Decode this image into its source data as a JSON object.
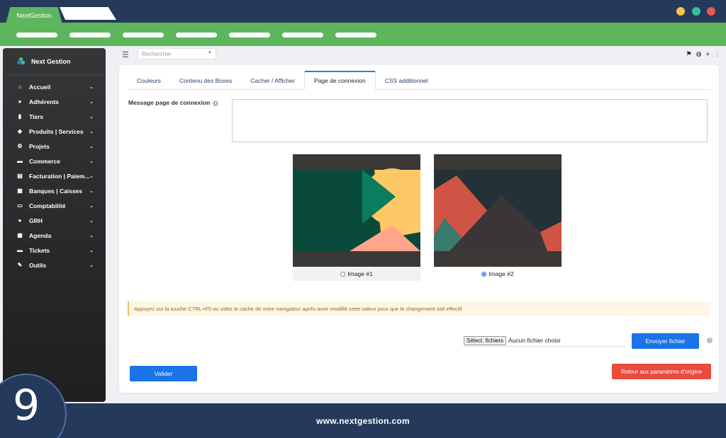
{
  "browser": {
    "tab_title": "NextGestion",
    "window_dots": [
      "#f5c542",
      "#3bbf9a",
      "#e9584f"
    ]
  },
  "sidebar": {
    "brand": "Next Gestion",
    "items": [
      {
        "label": "Accueil",
        "icon": "home-icon",
        "glyph": "⌂"
      },
      {
        "label": "Adhérents",
        "icon": "user-icon",
        "glyph": "●"
      },
      {
        "label": "Tiers",
        "icon": "building-icon",
        "glyph": "▮"
      },
      {
        "label": "Produits | Services",
        "icon": "cube-icon",
        "glyph": "◆"
      },
      {
        "label": "Projets",
        "icon": "project-icon",
        "glyph": "⚙"
      },
      {
        "label": "Commerce",
        "icon": "briefcase-icon",
        "glyph": "▬"
      },
      {
        "label": "Facturation | Paiem...",
        "icon": "invoice-icon",
        "glyph": "▤"
      },
      {
        "label": "Banques | Caisses",
        "icon": "bank-icon",
        "glyph": "▦"
      },
      {
        "label": "Comptabilité",
        "icon": "accounting-icon",
        "glyph": "▭"
      },
      {
        "label": "GRH",
        "icon": "user-tie-icon",
        "glyph": "●"
      },
      {
        "label": "Agenda",
        "icon": "calendar-icon",
        "glyph": "▦"
      },
      {
        "label": "Tickets",
        "icon": "ticket-icon",
        "glyph": "▬"
      },
      {
        "label": "Outils",
        "icon": "wrench-icon",
        "glyph": "✎"
      }
    ]
  },
  "topbar": {
    "search_placeholder": "Rechercher"
  },
  "main": {
    "tabs": [
      {
        "label": "Couleurs",
        "active": false
      },
      {
        "label": "Contenu des Boxes",
        "active": false
      },
      {
        "label": "Cacher / Afficher",
        "active": false
      },
      {
        "label": "Page de connexion",
        "active": true
      },
      {
        "label": "CSS additionnel",
        "active": false
      }
    ],
    "message_label": "Message page de connexion",
    "message_value": "",
    "images": [
      {
        "label": "Image #1",
        "checked": false
      },
      {
        "label": "Image #2",
        "checked": true
      }
    ],
    "alert": "Appuyez sur la touche CTRL+F5 ou videz le cache de votre navigateur après avoir modifié cette valeur pour que le changement soit effectif",
    "file_button": "Sélect. fichiers",
    "file_status": "Aucun fichier choisi",
    "send_button": "Envoyer fichier",
    "submit_button": "Valider",
    "reset_button": "Retour aux paramètres d'origine"
  },
  "footer": {
    "url": "www.nextgestion.com",
    "step": "9"
  }
}
